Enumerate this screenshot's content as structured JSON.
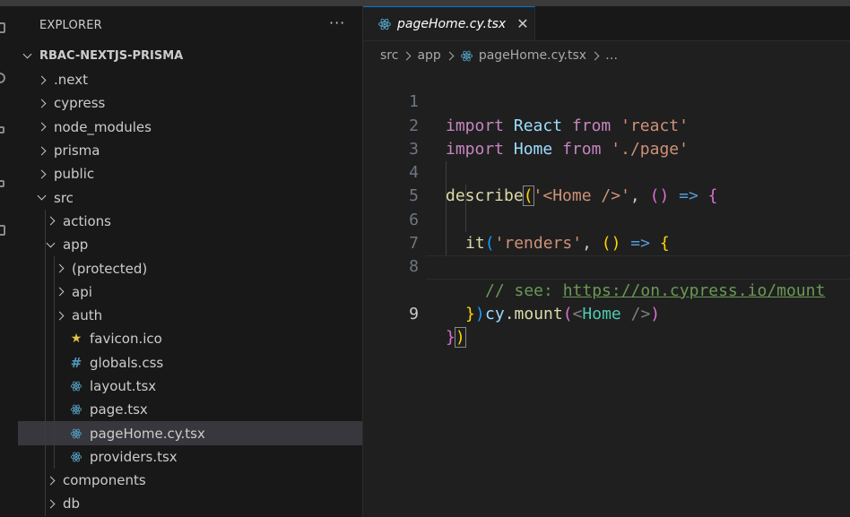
{
  "explorer": {
    "title": "EXPLORER",
    "more": "···",
    "root": "RBAC-NEXTJS-PRISMA",
    "items": [
      {
        "label": ".next",
        "depth": 0,
        "kind": "folder-closed"
      },
      {
        "label": "cypress",
        "depth": 0,
        "kind": "folder-closed"
      },
      {
        "label": "node_modules",
        "depth": 0,
        "kind": "folder-closed"
      },
      {
        "label": "prisma",
        "depth": 0,
        "kind": "folder-closed"
      },
      {
        "label": "public",
        "depth": 0,
        "kind": "folder-closed"
      },
      {
        "label": "src",
        "depth": 0,
        "kind": "folder-open"
      },
      {
        "label": "actions",
        "depth": 1,
        "kind": "folder-closed"
      },
      {
        "label": "app",
        "depth": 1,
        "kind": "folder-open"
      },
      {
        "label": "(protected)",
        "depth": 2,
        "kind": "folder-closed"
      },
      {
        "label": "api",
        "depth": 2,
        "kind": "folder-closed"
      },
      {
        "label": "auth",
        "depth": 2,
        "kind": "folder-closed"
      },
      {
        "label": "favicon.ico",
        "depth": 2,
        "kind": "file",
        "icon": "star-icon"
      },
      {
        "label": "globals.css",
        "depth": 2,
        "kind": "file",
        "icon": "hash-icon"
      },
      {
        "label": "layout.tsx",
        "depth": 2,
        "kind": "file",
        "icon": "react-icon"
      },
      {
        "label": "page.tsx",
        "depth": 2,
        "kind": "file",
        "icon": "react-icon"
      },
      {
        "label": "pageHome.cy.tsx",
        "depth": 2,
        "kind": "file",
        "icon": "react-icon",
        "selected": true
      },
      {
        "label": "providers.tsx",
        "depth": 2,
        "kind": "file",
        "icon": "react-icon"
      },
      {
        "label": "components",
        "depth": 1,
        "kind": "folder-closed"
      },
      {
        "label": "db",
        "depth": 1,
        "kind": "folder-closed"
      }
    ]
  },
  "tab": {
    "label": "pageHome.cy.tsx",
    "close": "✕"
  },
  "breadcrumb": {
    "part1": "src",
    "part2": "app",
    "file": "pageHome.cy.tsx",
    "more": "…"
  },
  "code": {
    "line_numbers": [
      "1",
      "2",
      "3",
      "4",
      "5",
      "6",
      "7",
      "8",
      "9"
    ],
    "l1": {
      "kw": "import",
      "name": "React",
      "from": "from",
      "str": "'react'"
    },
    "l2": {
      "kw": "import",
      "name": "Home",
      "from": "from",
      "str": "'./page'"
    },
    "l4": {
      "fn": "describe",
      "open": "(",
      "str": "'<Home />'",
      "comma": ", ",
      "args": "()",
      "arrow": "=>",
      "brace": "{"
    },
    "l5": {
      "fn": "it",
      "open": "(",
      "str": "'renders'",
      "comma": ", ",
      "args": "()",
      "arrow": "=>",
      "brace": "{"
    },
    "l6": {
      "comment": "// see: ",
      "url": "https://on.cypress.io/mount"
    },
    "l7": {
      "obj": "cy",
      "dot": ".",
      "fn": "mount",
      "open": "(",
      "lt": "<",
      "tag": "Home",
      "close": " />",
      "end": ")"
    },
    "l8": {
      "brace": "}",
      "paren": ")"
    },
    "l9": {
      "brace": "}",
      "paren": ")"
    }
  },
  "colors": {
    "accent": "#0078d4",
    "selection": "#37373d",
    "sidebar": "#181818",
    "editor": "#1f1f1f"
  }
}
